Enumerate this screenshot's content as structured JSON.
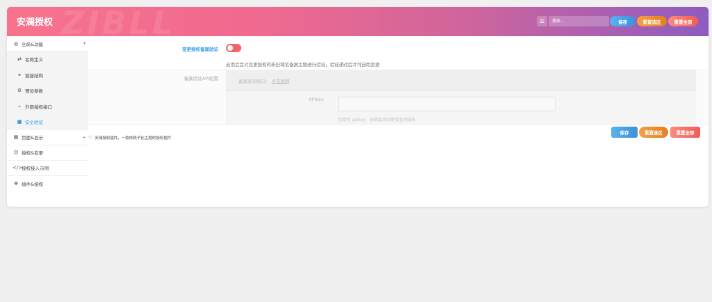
{
  "header": {
    "title": "安澜授权",
    "watermark": "ZIBLL",
    "search_placeholder": "搜索...",
    "save_label": "保存",
    "reset_section_label": "重置选区",
    "reset_all_label": "重置全部"
  },
  "sidebar": {
    "groups": [
      {
        "label": "全局&功能",
        "icon": "globe-icon",
        "expanded": true,
        "items": [
          {
            "label": "名称定义",
            "icon": "repeat-icon"
          },
          {
            "label": "链接结构",
            "icon": "link-icon"
          },
          {
            "label": "预设参数",
            "icon": "gears-icon"
          },
          {
            "label": "外部授权接口",
            "icon": "plug-icon"
          },
          {
            "label": "安全验证",
            "icon": "lock-icon",
            "active": true
          }
        ]
      },
      {
        "label": "页面&显示",
        "icon": "calendar-icon"
      },
      {
        "label": "授权&变更",
        "icon": "smile-icon"
      },
      {
        "label": "授权接入示例",
        "icon": "code-icon"
      },
      {
        "label": "插件&授权",
        "icon": "handshake-icon"
      }
    ]
  },
  "content": {
    "toggle_label": "变更授权备案验证",
    "toggle_on": false,
    "toggle_desc": "启用后会对变更授权的新旧域名备案主题进行验证，验证通过后才可自助变更",
    "api_section_label": "备案验证API配置",
    "api_endpoint_label": "备案查询接口：",
    "api_endpoint_link": "点击跳转",
    "apikey_label": "APIKey",
    "apikey_value": "",
    "apikey_hint": "仅填写 apikey，系统会自动拼接查询域名"
  },
  "footer": {
    "note": "安澜授权插件，一款依赖子比主题的授权插件",
    "save_label": "保存",
    "reset_section_label": "重置选区",
    "reset_all_label": "重置全部"
  },
  "colors": {
    "accent_blue": "#3a9de8",
    "toggle_off_red": "#f06565",
    "header_gradient_start": "#f7738d",
    "header_gradient_end": "#8e5cc0"
  }
}
